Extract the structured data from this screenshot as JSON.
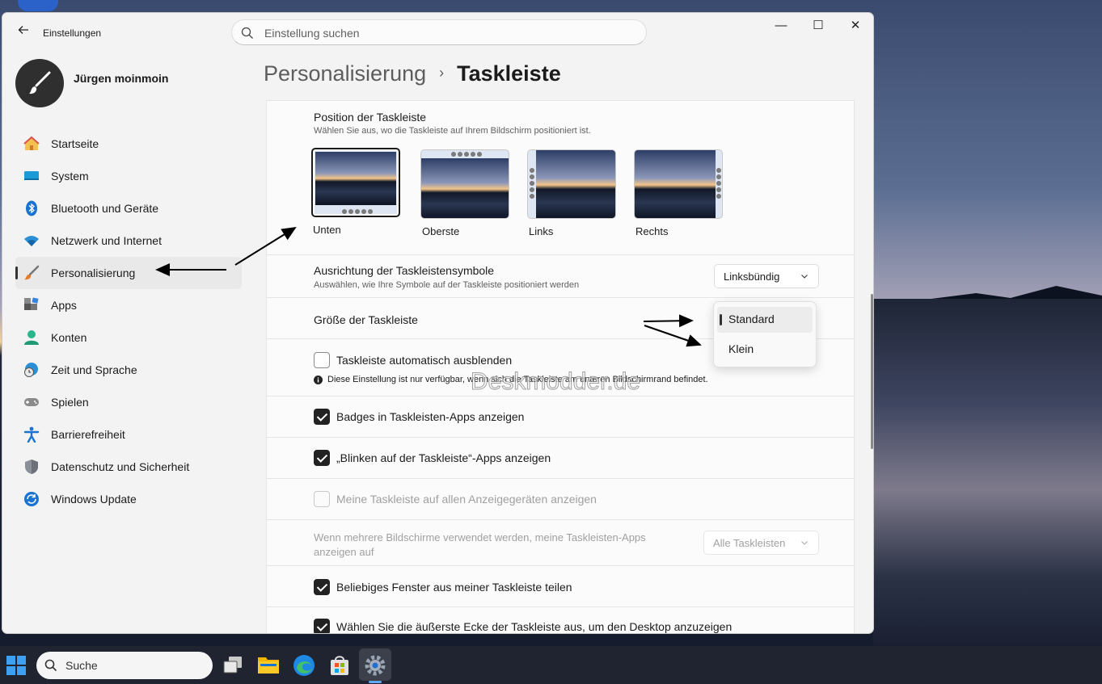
{
  "window": {
    "title": "Einstellungen",
    "search_placeholder": "Einstellung suchen",
    "controls": {
      "minimize": "—",
      "maximize": "☐",
      "close": "✕"
    }
  },
  "user": {
    "name": "Jürgen moinmoin"
  },
  "sidebar": {
    "items": [
      {
        "label": "Startseite",
        "icon": "home-icon"
      },
      {
        "label": "System",
        "icon": "system-icon"
      },
      {
        "label": "Bluetooth und Geräte",
        "icon": "bluetooth-icon"
      },
      {
        "label": "Netzwerk und Internet",
        "icon": "wifi-icon"
      },
      {
        "label": "Personalisierung",
        "icon": "brush-icon",
        "active": true
      },
      {
        "label": "Apps",
        "icon": "apps-icon"
      },
      {
        "label": "Konten",
        "icon": "account-icon"
      },
      {
        "label": "Zeit und Sprache",
        "icon": "globe-clock-icon"
      },
      {
        "label": "Spielen",
        "icon": "gamepad-icon"
      },
      {
        "label": "Barrierefreiheit",
        "icon": "accessibility-icon"
      },
      {
        "label": "Datenschutz und Sicherheit",
        "icon": "shield-icon"
      },
      {
        "label": "Windows Update",
        "icon": "update-icon"
      }
    ]
  },
  "breadcrumb": {
    "parent": "Personalisierung",
    "separator": "›",
    "current": "Taskleiste"
  },
  "position": {
    "title": "Position der Taskleiste",
    "subtitle": "Wählen Sie aus, wo die Taskleiste auf Ihrem Bildschirm positioniert ist.",
    "options": [
      {
        "label": "Unten",
        "selected": true
      },
      {
        "label": "Oberste",
        "selected": false
      },
      {
        "label": "Links",
        "selected": false
      },
      {
        "label": "Rechts",
        "selected": false
      }
    ]
  },
  "alignment": {
    "title": "Ausrichtung der Taskleistensymbole",
    "subtitle": "Auswählen, wie Ihre Symbole auf der Taskleiste positioniert werden",
    "value": "Linksbündig"
  },
  "size": {
    "title": "Größe der Taskleiste",
    "options": [
      {
        "label": "Standard",
        "selected": true
      },
      {
        "label": "Klein",
        "selected": false
      }
    ]
  },
  "settings": {
    "autohide": {
      "label": "Taskleiste automatisch ausblenden",
      "checked": false,
      "note": "Diese Einstellung ist nur verfügbar, wenn sich die Taskleiste am unteren Bildschirmrand befindet."
    },
    "badges": {
      "label": "Badges in Taskleisten-Apps anzeigen",
      "checked": true
    },
    "flash": {
      "label": "„Blinken auf der Taskleiste“-Apps anzeigen",
      "checked": true
    },
    "all_displays": {
      "label": "Meine Taskleiste auf allen Anzeigegeräten anzeigen",
      "checked": false,
      "disabled": true
    },
    "multi_monitor": {
      "label": "Wenn mehrere Bildschirme verwendet werden, meine Taskleisten-Apps anzeigen auf",
      "value": "Alle Taskleisten",
      "disabled": true
    },
    "share_window": {
      "label": "Beliebiges Fenster aus meiner Taskleiste teilen",
      "checked": true
    },
    "corner_desktop": {
      "label": "Wählen Sie die äußerste Ecke der Taskleiste aus, um den Desktop anzuzeigen",
      "checked": true
    }
  },
  "watermark": "Deskmodder.de",
  "taskbar": {
    "search_label": "Suche",
    "apps": [
      "start-icon",
      "task-view-icon",
      "file-explorer-icon",
      "edge-icon",
      "store-icon",
      "settings-icon"
    ]
  },
  "colors": {
    "accent": "#1b1b1b",
    "window_bg": "#f3f3f3",
    "card_bg": "#fbfbfb",
    "taskbar_bg": "#1f2430"
  }
}
